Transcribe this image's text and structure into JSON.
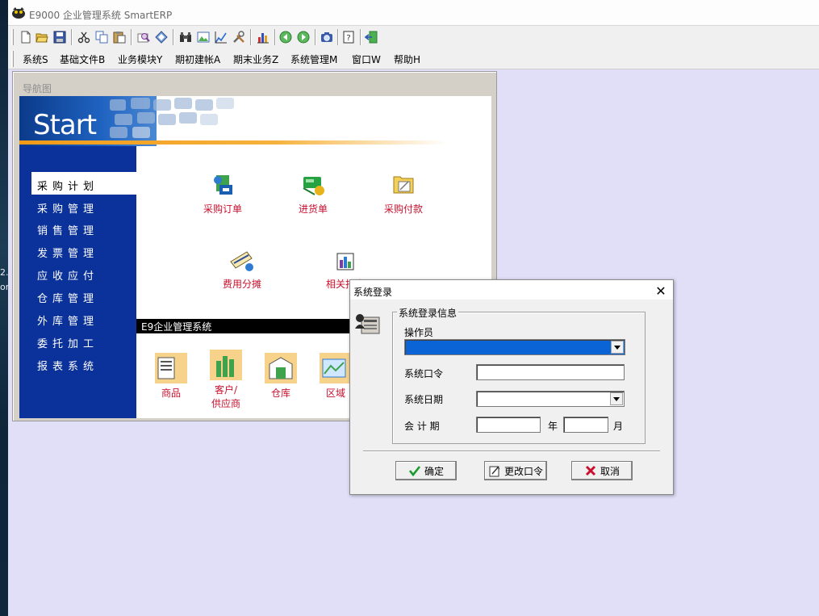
{
  "window": {
    "title": "E9000 企业管理系统 SmartERP"
  },
  "desktop": {
    "left_text_1": "2.",
    "left_text_2": "on"
  },
  "toolbar": {
    "buttons": [
      "new-file-icon",
      "open-folder-icon",
      "save-icon",
      "cut-icon",
      "copy-icon",
      "paste-icon",
      "search-doc-icon",
      "diamond-icon",
      "binoculars-icon",
      "image-icon",
      "chart-edit-icon",
      "tools-icon",
      "bar-chart-icon",
      "back-icon",
      "forward-icon",
      "camera-icon",
      "help-icon",
      "exit-icon"
    ]
  },
  "menu": {
    "items": [
      "系统S",
      "基础文件B",
      "业务模块Y",
      "期初建帐A",
      "期末业务Z",
      "系统管理M",
      "窗口W",
      "帮助H"
    ]
  },
  "nav": {
    "title": "导航图",
    "start": "Start",
    "side_items": [
      "采购计划",
      "采购管理",
      "销售管理",
      "发票管理",
      "应收应付",
      "仓库管理",
      "外库管理",
      "委托加工",
      "报表系统"
    ],
    "module_icons": [
      {
        "label": "采购订单",
        "icon": "purchase-order-icon"
      },
      {
        "label": "进货单",
        "icon": "receipt-icon"
      },
      {
        "label": "采购付款",
        "icon": "payment-icon"
      },
      {
        "label": "费用分摊",
        "icon": "expense-icon"
      },
      {
        "label": "相关报表",
        "icon": "report-icon"
      }
    ],
    "bar_title": "E9企业管理系统",
    "base_icons": [
      {
        "label": "商品",
        "icon": "goods-icon"
      },
      {
        "label": "客户/",
        "label2": "供应商",
        "icon": "customer-icon"
      },
      {
        "label": "仓库",
        "icon": "warehouse-icon"
      },
      {
        "label": "区域",
        "icon": "region-icon"
      }
    ]
  },
  "login": {
    "title": "系统登录",
    "group_title": "系统登录信息",
    "operator_label": "操作员",
    "operator_value": "",
    "password_label": "系统口令",
    "date_label": "系统日期",
    "period_label": "会 计 期",
    "year_label": "年",
    "month_label": "月",
    "ok_label": "确定",
    "change_pwd_label": "更改口令",
    "cancel_label": "取消"
  },
  "colors": {
    "nav_blue": "#0b329b",
    "accent_red": "#c8102e",
    "mdi_bg": "#e0dff7",
    "selection": "#0a64d6"
  }
}
